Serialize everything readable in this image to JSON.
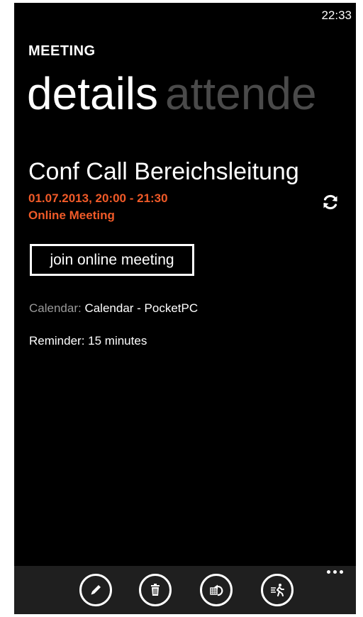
{
  "status_bar": {
    "time": "22:33"
  },
  "app": {
    "title": "MEETING"
  },
  "pivot": {
    "tabs": [
      "details",
      "attende"
    ]
  },
  "meeting": {
    "title": "Conf Call Bereichsleitung",
    "datetime": "01.07.2013, 20:00 - 21:30",
    "type": "Online Meeting",
    "join_label": "join online meeting",
    "calendar_label": "Calendar:",
    "calendar_value": "Calendar - PocketPC",
    "reminder_label": "Reminder:",
    "reminder_value": "15 minutes"
  },
  "app_bar": {
    "buttons": [
      "edit-icon",
      "delete-icon",
      "respond-icon",
      "running-late-icon"
    ],
    "more": "more-icon"
  },
  "colors": {
    "accent": "#f05a28",
    "background": "#000000",
    "app_bar": "#1f1f1f",
    "secondary_text": "#9a9a9a",
    "inactive_pivot": "#4a4a4a"
  }
}
